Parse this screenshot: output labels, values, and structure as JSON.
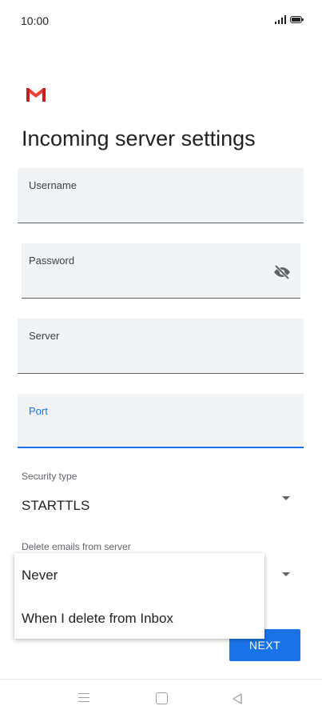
{
  "status_bar": {
    "time": "10:00"
  },
  "page": {
    "title": "Incoming server settings"
  },
  "fields": {
    "username": {
      "label": "Username",
      "value": ""
    },
    "password": {
      "label": "Password",
      "value": ""
    },
    "server": {
      "label": "Server",
      "value": ""
    },
    "port": {
      "label": "Port",
      "value": ""
    }
  },
  "security": {
    "label": "Security type",
    "value": "STARTTLS"
  },
  "delete_emails": {
    "label": "Delete emails from server",
    "options": [
      "Never",
      "When I delete from Inbox"
    ]
  },
  "actions": {
    "next_label": "NEXT"
  },
  "colors": {
    "accent": "#1a73e8",
    "field_bg": "#f1f3f4",
    "gmail_red": "#ea4335"
  },
  "icons": [
    "signal-icon",
    "battery-icon",
    "gmail-logo",
    "visibility-off-icon",
    "dropdown-arrow-icon",
    "nav-menu-icon",
    "nav-home-icon",
    "nav-back-icon"
  ]
}
